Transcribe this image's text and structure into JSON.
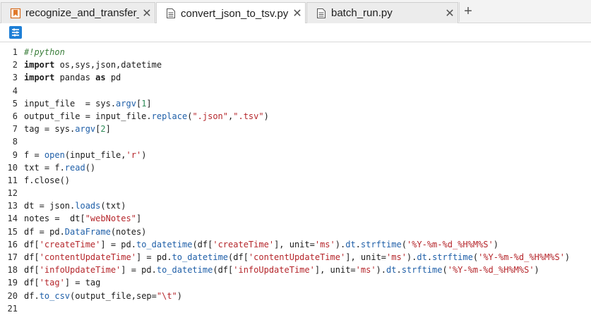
{
  "tabs": [
    {
      "label": "recognize_and_transfer_nc",
      "icon": "bookmark-file-icon",
      "active": false,
      "close": "✕"
    },
    {
      "label": "convert_json_to_tsv.py",
      "icon": "text-file-icon",
      "active": true,
      "close": "✕"
    },
    {
      "label": "batch_run.py",
      "icon": "text-file-icon",
      "active": false,
      "close": "✕"
    }
  ],
  "add_tab": "+",
  "toolbar": {
    "icon": "outline-list-icon"
  },
  "colors": {
    "accent": "#1e7fd6",
    "comment": "#3c7f3c",
    "string": "#b5262b",
    "function": "#1f5fa8"
  },
  "code_lines": [
    {
      "n": "1",
      "text": "#!python"
    },
    {
      "n": "2",
      "text": "import os,sys,json,datetime"
    },
    {
      "n": "3",
      "text": "import pandas as pd"
    },
    {
      "n": "4",
      "text": ""
    },
    {
      "n": "5",
      "text": "input_file  = sys.argv[1]"
    },
    {
      "n": "6",
      "text": "output_file = input_file.replace(\".json\",\".tsv\")"
    },
    {
      "n": "7",
      "text": "tag = sys.argv[2]"
    },
    {
      "n": "8",
      "text": ""
    },
    {
      "n": "9",
      "text": "f = open(input_file,'r')"
    },
    {
      "n": "10",
      "text": "txt = f.read()"
    },
    {
      "n": "11",
      "text": "f.close()"
    },
    {
      "n": "12",
      "text": ""
    },
    {
      "n": "13",
      "text": "dt = json.loads(txt)"
    },
    {
      "n": "14",
      "text": "notes =  dt[\"webNotes\"]"
    },
    {
      "n": "15",
      "text": "df = pd.DataFrame(notes)"
    },
    {
      "n": "16",
      "text": "df['createTime'] = pd.to_datetime(df['createTime'], unit='ms').dt.strftime('%Y-%m-%d_%H%M%S')"
    },
    {
      "n": "17",
      "text": "df['contentUpdateTime'] = pd.to_datetime(df['contentUpdateTime'], unit='ms').dt.strftime('%Y-%m-%d_%H%M%S')"
    },
    {
      "n": "18",
      "text": "df['infoUpdateTime'] = pd.to_datetime(df['infoUpdateTime'], unit='ms').dt.strftime('%Y-%m-%d_%H%M%S')"
    },
    {
      "n": "19",
      "text": "df['tag'] = tag"
    },
    {
      "n": "20",
      "text": "df.to_csv(output_file,sep=\"\\t\")"
    },
    {
      "n": "21",
      "text": ""
    }
  ]
}
